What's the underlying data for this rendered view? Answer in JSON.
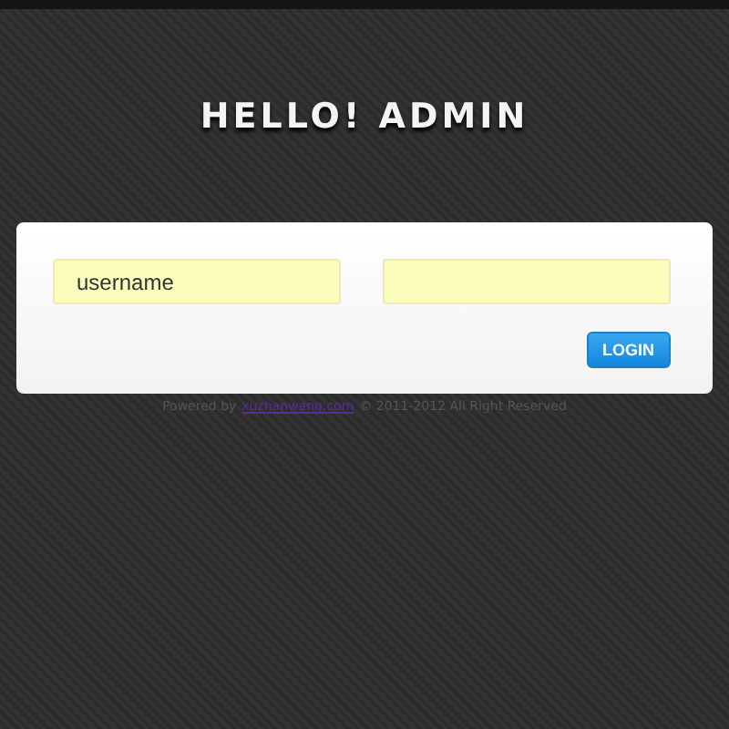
{
  "title": "HELLO! ADMIN",
  "form": {
    "username": {
      "value": "username"
    },
    "button": "LOGIN"
  },
  "footer": {
    "before": "Powered by",
    "link": "xuzhanwang.com",
    "after": "© 2011-2012 All Right Reserved"
  }
}
